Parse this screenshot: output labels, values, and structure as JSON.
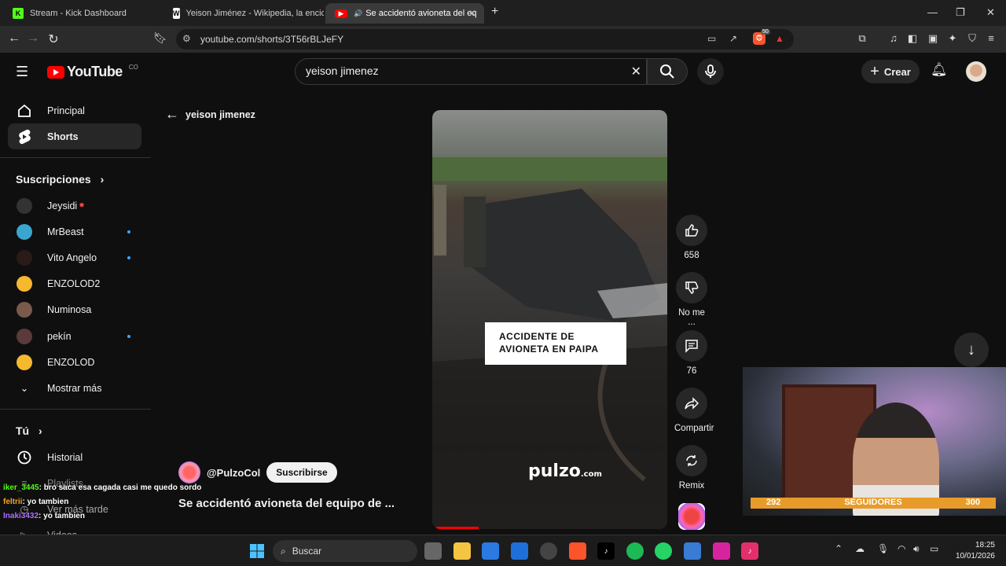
{
  "browser": {
    "tabs": [
      {
        "title": "Stream - Kick Dashboard",
        "icon": "kick-icon",
        "color": "#53fc18"
      },
      {
        "title": "Yeison Jiménez - Wikipedia, la encicl",
        "icon": "wikipedia-icon",
        "color": "#ffffff"
      },
      {
        "title": "Se accidentó avioneta del eq",
        "icon": "youtube-icon",
        "color": "#ff0000"
      }
    ],
    "url": "youtube.com/shorts/3T56rBLJeFY",
    "brave_badge": "50"
  },
  "youtube": {
    "logo": "YouTube",
    "country": "CO",
    "search_value": "yeison jimenez",
    "create_label": "Crear",
    "nav": [
      {
        "label": "Principal",
        "icon": "home-icon"
      },
      {
        "label": "Shorts",
        "icon": "shorts-icon"
      }
    ],
    "subs_header": "Suscripciones",
    "subscriptions": [
      {
        "name": "Jeysidi",
        "color": "#333",
        "live": true,
        "dot": false
      },
      {
        "name": "MrBeast",
        "color": "#3aa6d0",
        "live": false,
        "dot": true
      },
      {
        "name": "Vito Angelo",
        "color": "#2a1a18",
        "live": false,
        "dot": true
      },
      {
        "name": "ENZOLOD2",
        "color": "#f5b82e",
        "live": false,
        "dot": false
      },
      {
        "name": "Numinosa",
        "color": "#7a5a4a",
        "live": false,
        "dot": false
      },
      {
        "name": "pekín",
        "color": "#5a3a3a",
        "live": false,
        "dot": true
      },
      {
        "name": "ENZOLOD",
        "color": "#f5b82e",
        "live": false,
        "dot": false
      }
    ],
    "show_more": "Mostrar más",
    "you_header": "Tú",
    "history": "Historial",
    "playlists": "Playlists",
    "watch_later": "Ver más tarde",
    "videos": "Videos",
    "back_query": "yeison jimenez",
    "video": {
      "overlay_text": "ACCIDENTE DE AVIONETA EN PAIPA",
      "brand": "pulzo",
      "brand_suffix": ".com",
      "channel": "@PulzoCol",
      "subscribe": "Suscribirse",
      "title": "Se accidentó avioneta del equipo de ...",
      "progress": 0.18
    },
    "actions": [
      {
        "icon": "like-icon",
        "label": "658"
      },
      {
        "icon": "dislike-icon",
        "label": "No me ..."
      },
      {
        "icon": "comment-icon",
        "label": "76"
      },
      {
        "icon": "share-icon",
        "label": "Compartir"
      },
      {
        "icon": "remix-icon",
        "label": "Remix"
      }
    ]
  },
  "stream": {
    "followers_current": "292",
    "followers_label": "SEGUIDORES",
    "followers_goal": "300",
    "chat": [
      {
        "user": "iker_3445",
        "color": "#53fc18",
        "msg": ": bro saca esa cagada casi me quedo sordo"
      },
      {
        "user": "feltrii",
        "color": "#f5a623",
        "msg": ": yo tambien"
      },
      {
        "user": "Inaki3432",
        "color": "#a970ff",
        "msg": ": yo tambien"
      }
    ]
  },
  "taskbar": {
    "search": "Buscar",
    "time": "18:25",
    "date": "10/01/2026"
  }
}
